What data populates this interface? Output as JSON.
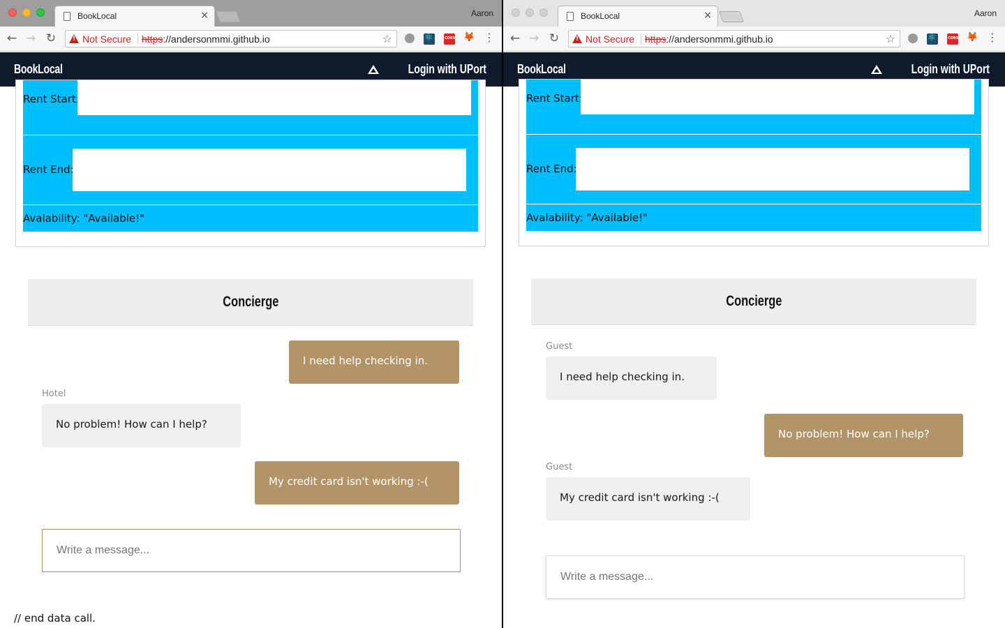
{
  "browser": {
    "tab_title": "BookLocal",
    "tab_close": "×",
    "profile_name": "Aaron",
    "security_label": "Not Secure",
    "url_scheme": "https",
    "url_rest": "://andersonmmi.github.io",
    "back_glyph": "←",
    "forward_glyph": "→",
    "reload_glyph": "↻",
    "star_glyph": "☆",
    "menu_glyph": "⋮",
    "extensions": [
      "bug-icon",
      "react-devtools-icon",
      "cors-icon",
      "metamask-fox-icon"
    ]
  },
  "navbar": {
    "brand": "BookLocal",
    "login_label": "Login with UPort",
    "background": "#0f1b2d"
  },
  "form": {
    "rent_start_label": "Rent Start:",
    "rent_end_label": "Rent End:",
    "availability_label": "Avalability: \"Available!\"",
    "row_color": "#00bfff"
  },
  "chat": {
    "title": "Concierge",
    "input_placeholder": "Write a message...",
    "outgoing_color": "#b29468",
    "incoming_color": "#efefef",
    "left_view": {
      "messages": [
        {
          "text": "I need help checking in.",
          "direction": "out",
          "sender": ""
        },
        {
          "text": "No problem! How can I help?",
          "direction": "in",
          "sender": "Hotel"
        },
        {
          "text": "My credit card isn't working :-(",
          "direction": "out",
          "sender": ""
        }
      ]
    },
    "right_view": {
      "messages": [
        {
          "text": "I need help checking in.",
          "direction": "in",
          "sender": "Guest"
        },
        {
          "text": "No problem! How can I help?",
          "direction": "out",
          "sender": ""
        },
        {
          "text": "My credit card isn't working :-(",
          "direction": "in",
          "sender": "Guest"
        }
      ]
    }
  },
  "footer": {
    "text": "// end data call."
  }
}
